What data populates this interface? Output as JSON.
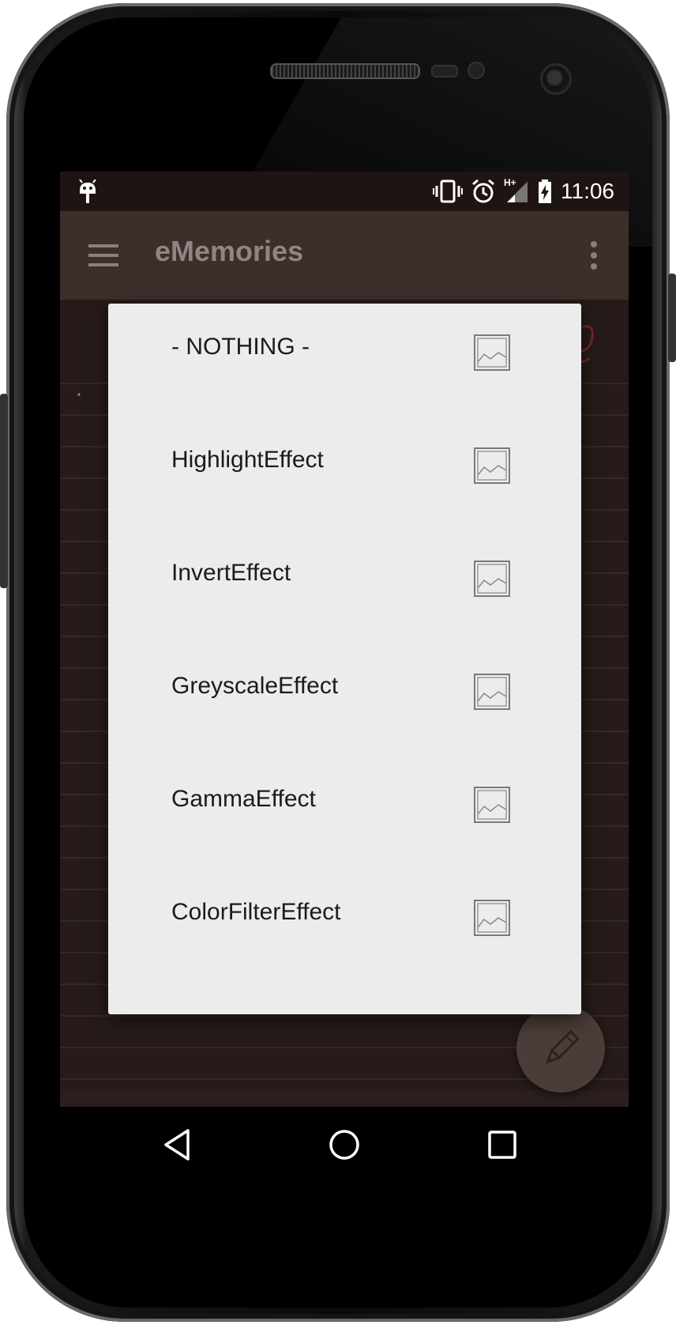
{
  "status_bar": {
    "time": "11:06",
    "network_type": "H+"
  },
  "app_bar": {
    "title": "eMemories"
  },
  "dialog": {
    "effects": [
      {
        "label": "- NOTHING -",
        "icon": "image-placeholder-icon"
      },
      {
        "label": "HighlightEffect",
        "icon": "image-placeholder-icon"
      },
      {
        "label": "InvertEffect",
        "icon": "image-placeholder-icon"
      },
      {
        "label": "GreyscaleEffect",
        "icon": "image-placeholder-icon"
      },
      {
        "label": "GammaEffect",
        "icon": "image-placeholder-icon"
      },
      {
        "label": "ColorFilterEffect",
        "icon": "image-placeholder-icon"
      }
    ]
  },
  "colors": {
    "app_bar": "#3c2e2b",
    "status_bar": "#1e1513",
    "dialog_background": "#ececec",
    "paper_background": "#261b19"
  }
}
